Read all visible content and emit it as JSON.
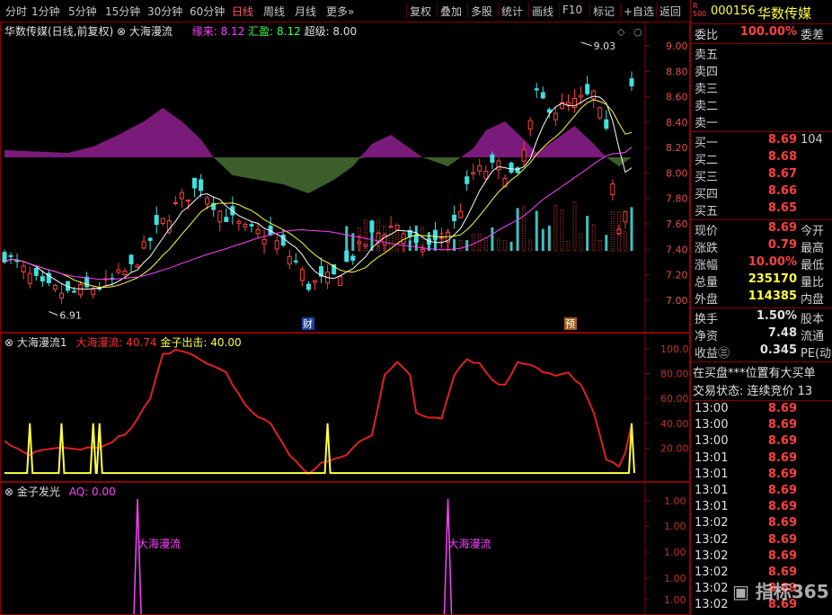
{
  "toolbar": {
    "periods": [
      "分时",
      "1分钟",
      "5分钟",
      "15分钟",
      "30分钟",
      "60分钟",
      "日线",
      "周线",
      "月线",
      "更多»"
    ],
    "active_period": "日线",
    "tools": [
      "复权",
      "叠加",
      "多股",
      "统计",
      "画线",
      "F10",
      "标记",
      "+自选",
      "返回"
    ]
  },
  "main_chart": {
    "title": "华数传媒(日线,前复权)",
    "indicator_name": "大海漫流",
    "legend": [
      {
        "label": "缘来:",
        "value": "8.12",
        "color": "#ff40ff"
      },
      {
        "label": "汇盈:",
        "value": "8.12",
        "color": "#40ff40"
      },
      {
        "label": "超级:",
        "value": "8.00",
        "color": "#e0e0e0"
      }
    ],
    "y_ticks": [
      "9.00",
      "8.80",
      "8.60",
      "8.40",
      "8.20",
      "8.00",
      "7.80",
      "7.60",
      "7.40",
      "7.20",
      "7.00"
    ],
    "high_label": "9.03",
    "low_label": "6.91",
    "markers": [
      "财",
      "预"
    ]
  },
  "indicator1": {
    "name": "大海漫流1",
    "legend": [
      {
        "label": "大海漫流:",
        "value": "40.74",
        "color": "#ff3030"
      },
      {
        "label": "金子出击:",
        "value": "40.00",
        "color": "#ffff40"
      }
    ],
    "y_ticks": [
      "100.0",
      "80.00",
      "60.00",
      "40.00",
      "20.00"
    ]
  },
  "indicator2": {
    "name": "金子发光",
    "legend": [
      {
        "label": "AQ:",
        "value": "0.00",
        "color": "#ff40ff"
      }
    ],
    "y_ticks": [
      "1.00",
      "1.00",
      "1.00",
      "1.00",
      "1.00"
    ],
    "spike_label": "大海漫流"
  },
  "quote": {
    "badge": "R 500",
    "code": "000156",
    "name": "华数传媒",
    "webi": {
      "label": "委比",
      "value": "100.00%",
      "label2": "委差"
    },
    "asks": [
      {
        "label": "卖五",
        "price": "",
        "vol": ""
      },
      {
        "label": "卖四",
        "price": "",
        "vol": ""
      },
      {
        "label": "卖三",
        "price": "",
        "vol": ""
      },
      {
        "label": "卖二",
        "price": "",
        "vol": ""
      },
      {
        "label": "卖一",
        "price": "",
        "vol": ""
      }
    ],
    "bids": [
      {
        "label": "买一",
        "price": "8.69",
        "vol": "104"
      },
      {
        "label": "买二",
        "price": "8.68",
        "vol": ""
      },
      {
        "label": "买三",
        "price": "8.67",
        "vol": ""
      },
      {
        "label": "买四",
        "price": "8.66",
        "vol": ""
      },
      {
        "label": "买五",
        "price": "8.65",
        "vol": ""
      }
    ],
    "stats1": [
      {
        "label": "现价",
        "value": "8.69",
        "label2": "今开",
        "color": "#ff4040"
      },
      {
        "label": "涨跌",
        "value": "0.79",
        "label2": "最高",
        "color": "#ff4040"
      },
      {
        "label": "涨幅",
        "value": "10.00%",
        "label2": "最低",
        "color": "#ff4040"
      },
      {
        "label": "总量",
        "value": "235170",
        "label2": "量比",
        "color": "#ffff40"
      },
      {
        "label": "外盘",
        "value": "114385",
        "label2": "内盘",
        "color": "#ffff40"
      }
    ],
    "stats2": [
      {
        "label": "换手",
        "value": "1.50%",
        "label2": "股本",
        "color": "#e0e0e0"
      },
      {
        "label": "净资",
        "value": "7.48",
        "label2": "流通",
        "color": "#e0e0e0"
      },
      {
        "label": "收益㊂",
        "value": "0.345",
        "label2": "PE(动",
        "color": "#e0e0e0"
      }
    ],
    "notice1": "在买盘***位置有大买单",
    "notice2": "交易状态: 连续竞价 13",
    "ticks": [
      {
        "time": "13:00",
        "price": "8.69"
      },
      {
        "time": "13:00",
        "price": "8.69"
      },
      {
        "time": "13:00",
        "price": "8.69"
      },
      {
        "time": "13:01",
        "price": "8.69"
      },
      {
        "time": "13:01",
        "price": "8.69"
      },
      {
        "time": "13:01",
        "price": "8.69"
      },
      {
        "time": "13:01",
        "price": "8.69"
      },
      {
        "time": "13:02",
        "price": "8.69"
      },
      {
        "time": "13:02",
        "price": "8.69"
      },
      {
        "time": "13:02",
        "price": "8.69"
      },
      {
        "time": "13:02",
        "price": "8.69"
      },
      {
        "time": "13:02",
        "price": "8.69"
      },
      {
        "time": "13:02",
        "price": "8.69"
      }
    ],
    "watermark": "指标365"
  },
  "colors": {
    "up": "#ff4040",
    "down": "#40e0e0",
    "bg": "#000000",
    "border": "#8b0000",
    "magenta": "#ff40ff",
    "yellow": "#ffff40",
    "purple_area": "#800080",
    "green_area": "#3a6a2a"
  }
}
